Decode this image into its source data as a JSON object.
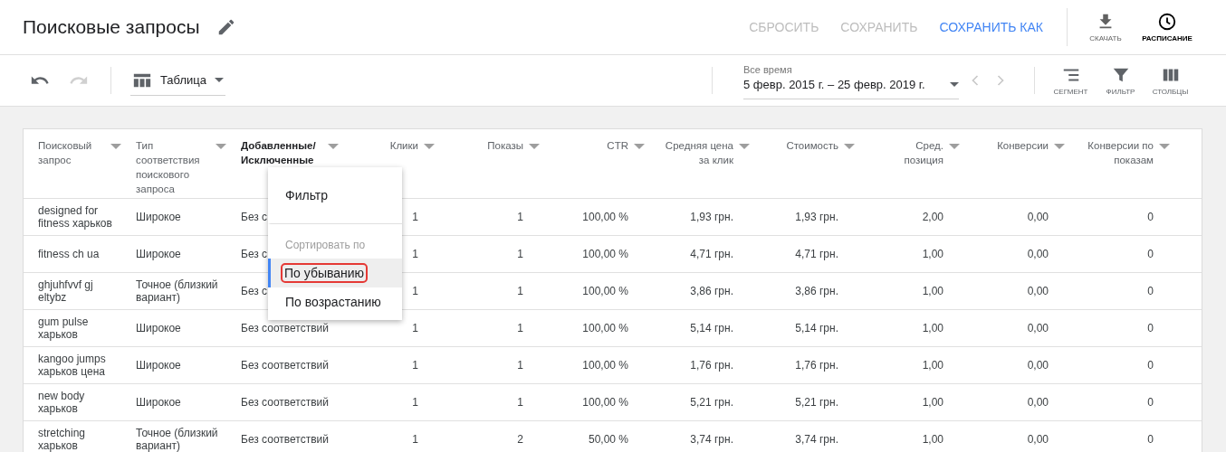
{
  "header": {
    "title": "Поисковые запросы",
    "actions": [
      {
        "label": "СБРОСИТЬ",
        "disabled": true
      },
      {
        "label": "СОХРАНИТЬ",
        "disabled": true
      },
      {
        "label": "СОХРАНИТЬ КАК",
        "disabled": false
      }
    ],
    "tools": [
      {
        "kind": "download",
        "label": "СКАЧАТЬ",
        "active": false
      },
      {
        "kind": "schedule",
        "label": "РАСПИСАНИЕ",
        "active": true
      }
    ]
  },
  "toolbar": {
    "undo": {
      "disabled": false
    },
    "redo": {
      "disabled": true
    },
    "view": {
      "value": "Таблица"
    },
    "date_range": {
      "label": "Все время",
      "value": "5 февр. 2015 г. – 25 февр. 2019 г."
    },
    "prev": {
      "disabled": true
    },
    "next": {
      "disabled": true
    },
    "tools": [
      {
        "kind": "segment",
        "label": "СЕГМЕНТ"
      },
      {
        "kind": "filter",
        "label": "ФИЛЬТР"
      },
      {
        "kind": "columns",
        "label": "СТОЛБЦЫ"
      }
    ]
  },
  "table": {
    "columns": [
      {
        "label": "Поисковый запрос",
        "kind": "text",
        "active": false
      },
      {
        "label": "Тип соответствия поискового запроса",
        "kind": "text",
        "active": false
      },
      {
        "label": "Добавленные/ Исключенные",
        "kind": "text",
        "active": true
      },
      {
        "label": "Клики",
        "kind": "number",
        "active": false
      },
      {
        "label": "Показы",
        "kind": "number",
        "active": false
      },
      {
        "label": "CTR",
        "kind": "number",
        "active": false
      },
      {
        "label": "Средняя цена за клик",
        "kind": "number",
        "active": false
      },
      {
        "label": "Стоимость",
        "kind": "number",
        "active": false
      },
      {
        "label": "Сред. позиция",
        "kind": "number",
        "active": false
      },
      {
        "label": "Конверсии",
        "kind": "number",
        "active": false
      },
      {
        "label": "Конверсии по показам",
        "kind": "number",
        "active": false
      }
    ],
    "rows": [
      [
        "designed for fitness харьков",
        "Широкое",
        "Без с",
        "1",
        "1",
        "100,00 %",
        "1,93 грн.",
        "1,93 грн.",
        "2,00",
        "0,00",
        "0"
      ],
      [
        "fitness ch ua",
        "Широкое",
        "Без с",
        "1",
        "1",
        "100,00 %",
        "4,71 грн.",
        "4,71 грн.",
        "1,00",
        "0,00",
        "0"
      ],
      [
        "ghjuhfvvf gj eltybz",
        "Точное (близкий вариант)",
        "Без с",
        "1",
        "1",
        "100,00 %",
        "3,86 грн.",
        "3,86 грн.",
        "1,00",
        "0,00",
        "0"
      ],
      [
        "gum pulse харьков",
        "Широкое",
        "Без соответствий",
        "1",
        "1",
        "100,00 %",
        "5,14 грн.",
        "5,14 грн.",
        "1,00",
        "0,00",
        "0"
      ],
      [
        "kangoo jumps харьков цена",
        "Широкое",
        "Без соответствий",
        "1",
        "1",
        "100,00 %",
        "1,76 грн.",
        "1,76 грн.",
        "1,00",
        "0,00",
        "0"
      ],
      [
        "new body харьков",
        "Широкое",
        "Без соответствий",
        "1",
        "1",
        "100,00 %",
        "5,21 грн.",
        "5,21 грн.",
        "1,00",
        "0,00",
        "0"
      ],
      [
        "stretching харьков",
        "Точное (близкий вариант)",
        "Без соответствий",
        "1",
        "2",
        "50,00 %",
        "3,74 грн.",
        "3,74 грн.",
        "1,00",
        "0,00",
        "0"
      ]
    ]
  },
  "column_menu": {
    "items": [
      {
        "kind": "action",
        "label": "Фильтр",
        "selected": false,
        "highlighted": false
      },
      {
        "kind": "heading",
        "label": "Сортировать по",
        "selected": false,
        "highlighted": false
      },
      {
        "kind": "action",
        "label": "По убыванию",
        "selected": true,
        "highlighted": true
      },
      {
        "kind": "action",
        "label": "По возрастанию",
        "selected": false,
        "highlighted": false
      }
    ]
  }
}
